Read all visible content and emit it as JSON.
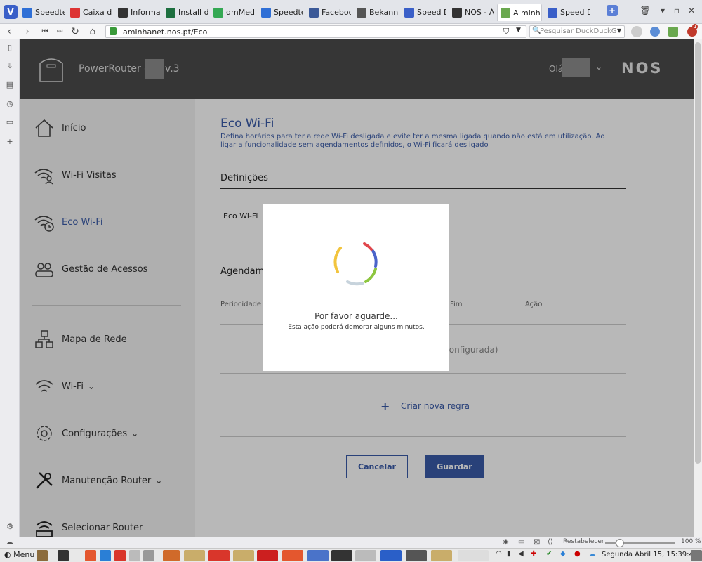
{
  "browser": {
    "tabs": [
      {
        "label": "Speedtes",
        "color": "#2f6fd6",
        "active": false
      },
      {
        "label": "Caixa de e",
        "color": "#d33",
        "active": false
      },
      {
        "label": "Informaç",
        "color": "#333",
        "active": false
      },
      {
        "label": "Install dm",
        "color": "#1d6f3f",
        "active": false
      },
      {
        "label": "dmMedia",
        "color": "#34a853",
        "active": false
      },
      {
        "label": "Speedtes",
        "color": "#2f6fd6",
        "active": false
      },
      {
        "label": "Facebook",
        "color": "#3b5998",
        "active": false
      },
      {
        "label": "Bekannte",
        "color": "#555",
        "active": false
      },
      {
        "label": "Speed Dia",
        "color": "#3a5fc8",
        "active": false
      },
      {
        "label": "NOS - Áre",
        "color": "#333",
        "active": false
      },
      {
        "label": "A minha N",
        "color": "#6aa84f",
        "active": true
      },
      {
        "label": "Speed Dia",
        "color": "#3a5fc8",
        "active": false
      }
    ],
    "url": "aminhanet.nos.pt/Eco",
    "search_placeholder": "Pesquisar DuckDuckG",
    "notification_count": "1"
  },
  "header": {
    "router_title_prefix": "PowerRouter do",
    "router_title_suffix": "v.3",
    "greeting": "Olá,",
    "brand": "NOS"
  },
  "sidebar": {
    "items": [
      {
        "label": "Início",
        "icon": "home-icon"
      },
      {
        "label": "Wi-Fi Visitas",
        "icon": "wifi-guest-icon"
      },
      {
        "label": "Eco Wi-Fi",
        "icon": "wifi-clock-icon"
      },
      {
        "label": "Gestão de Acessos",
        "icon": "users-icon"
      },
      {
        "label": "Mapa de Rede",
        "icon": "network-map-icon"
      },
      {
        "label": "Wi-Fi",
        "icon": "wifi-icon"
      },
      {
        "label": "Configurações",
        "icon": "gear-icon"
      },
      {
        "label": "Manutenção Router",
        "icon": "tools-icon"
      },
      {
        "label": "Selecionar Router",
        "icon": "router-icon"
      }
    ]
  },
  "main": {
    "title": "Eco Wi-Fi",
    "description": "Defina horários para ter a rede Wi-Fi desligada e evite ter a mesma ligada quando não está em utilização. Ao ligar a funcionalidade sem agendamentos definidos, o Wi-Fi ficará desligado",
    "section_definitions": "Definições",
    "eco_label": "Eco Wi-Fi",
    "section_schedules": "Agendame",
    "columns": {
      "periodicity": "Periocidade",
      "end": "Fim",
      "action": "Ação"
    },
    "empty_text": "a configurada)",
    "new_rule": "Criar nova regra",
    "cancel": "Cancelar",
    "save": "Guardar"
  },
  "modal": {
    "title": "Por favor aguarde...",
    "subtitle": "Esta ação poderá demorar alguns minutos."
  },
  "status": {
    "reset_label": "Restabelecer",
    "zoom": "100 %"
  },
  "taskbar": {
    "menu_label": "Menu",
    "clock": "Segunda Abril 15, 15:39:40"
  }
}
